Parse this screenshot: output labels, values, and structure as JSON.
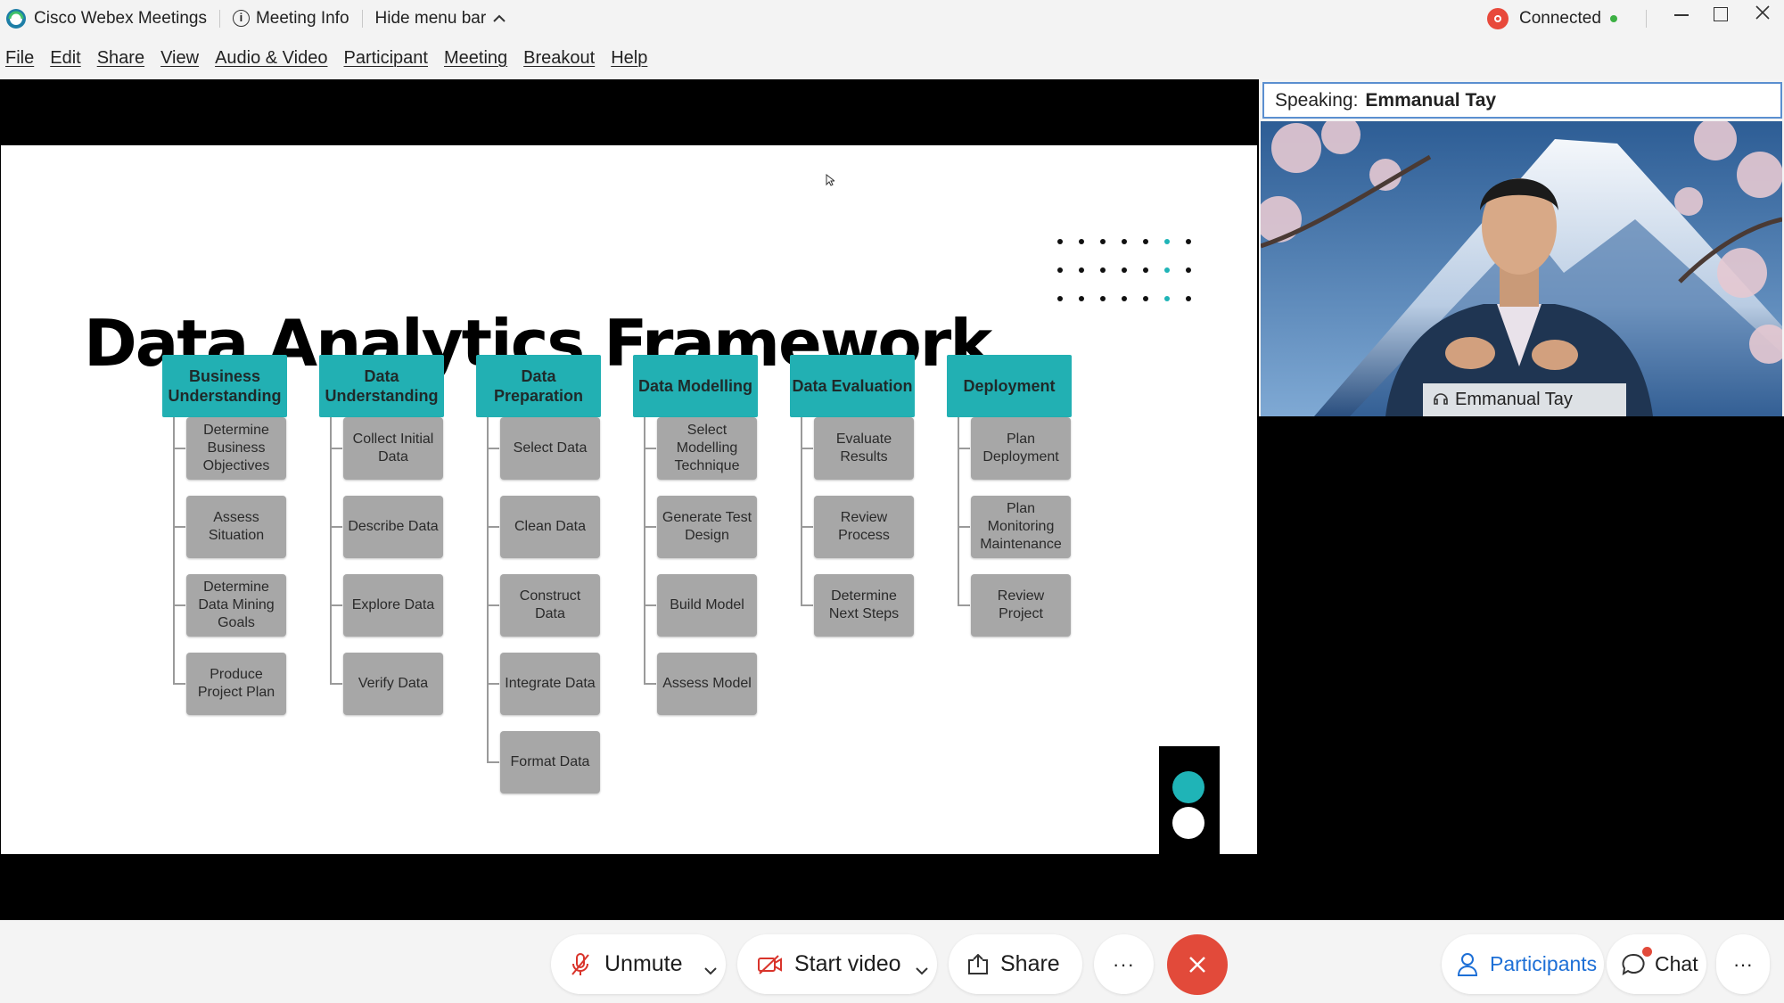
{
  "titlebar": {
    "app_name": "Cisco Webex Meetings",
    "meeting_info": "Meeting Info",
    "hide_menu": "Hide menu bar",
    "status": "Connected",
    "colors": {
      "status_badge": "#e8493b",
      "status_dot": "#3cb043"
    }
  },
  "menu": [
    "File",
    "Edit",
    "Share",
    "View",
    "Audio & Video",
    "Participant",
    "Meeting",
    "Breakout",
    "Help"
  ],
  "slide": {
    "title": "Data Analytics Framework",
    "columns": [
      {
        "head": "Business Understanding",
        "items": [
          "Determine Business Objectives",
          "Assess Situation",
          "Determine Data Mining Goals",
          "Produce Project Plan"
        ]
      },
      {
        "head": "Data Understanding",
        "items": [
          "Collect Initial Data",
          "Describe Data",
          "Explore Data",
          "Verify Data"
        ]
      },
      {
        "head": "Data Preparation",
        "items": [
          "Select Data",
          "Clean Data",
          "Construct Data",
          "Integrate Data",
          "Format Data"
        ]
      },
      {
        "head": "Data Modelling",
        "items": [
          "Select Modelling Technique",
          "Generate Test Design",
          "Build Model",
          "Assess Model"
        ]
      },
      {
        "head": "Data Evaluation",
        "items": [
          "Evaluate Results",
          "Review Process",
          "Determine Next Steps"
        ]
      },
      {
        "head": "Deployment",
        "items": [
          "Plan Deployment",
          "Plan Monitoring Maintenance",
          "Review Project"
        ]
      }
    ],
    "colors": {
      "head": "#22b0b3",
      "child": "#a7a7a7",
      "accent": "#1fb4b7"
    }
  },
  "speaker": {
    "label": "Speaking:",
    "name": "Emmanual Tay"
  },
  "video": {
    "name_tag": "Emmanual Tay"
  },
  "controls": {
    "unmute": "Unmute",
    "start_video": "Start video",
    "share": "Share",
    "more": "···",
    "participants": "Participants",
    "chat": "Chat",
    "colors": {
      "end": "#e24a3a",
      "accent_blue": "#1d6fd6",
      "mute_red": "#d9342b"
    }
  }
}
